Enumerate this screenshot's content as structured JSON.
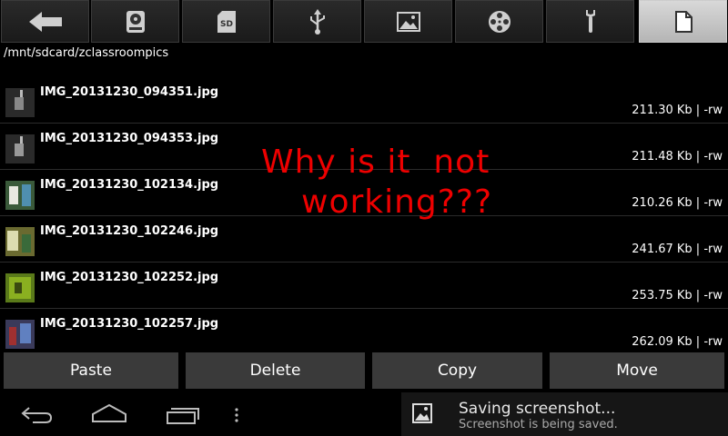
{
  "toolbar": {
    "items": [
      {
        "icon": "back-arrow-icon",
        "active": false
      },
      {
        "icon": "internal-storage-icon",
        "active": false
      },
      {
        "icon": "sd-card-icon",
        "active": false,
        "label": "SD"
      },
      {
        "icon": "usb-icon",
        "active": false
      },
      {
        "icon": "image-icon",
        "active": false
      },
      {
        "icon": "video-reel-icon",
        "active": false
      },
      {
        "icon": "wrench-icon",
        "active": false
      },
      {
        "icon": "file-icon",
        "active": true
      }
    ]
  },
  "path": "/mnt/sdcard/zclassroompics",
  "files": [
    {
      "name": "IMG_20131230_094351.jpg",
      "meta": "211.30 Kb  | -rw"
    },
    {
      "name": "IMG_20131230_094353.jpg",
      "meta": "211.48 Kb  | -rw"
    },
    {
      "name": "IMG_20131230_102134.jpg",
      "meta": "210.26 Kb  | -rw"
    },
    {
      "name": "IMG_20131230_102246.jpg",
      "meta": "241.67 Kb  | -rw"
    },
    {
      "name": "IMG_20131230_102252.jpg",
      "meta": "253.75 Kb  | -rw"
    },
    {
      "name": "IMG_20131230_102257.jpg",
      "meta": "262.09 Kb  | -rw"
    }
  ],
  "annotation": {
    "line1": "Why is it  not",
    "line2": "working???"
  },
  "actions": {
    "paste": "Paste",
    "delete": "Delete",
    "copy": "Copy",
    "move": "Move"
  },
  "notification": {
    "title": "Saving screenshot...",
    "subtitle": "Screenshot is being saved."
  },
  "colors": {
    "annotation": "#ee0000",
    "active_tab": "#c8c8c8"
  }
}
